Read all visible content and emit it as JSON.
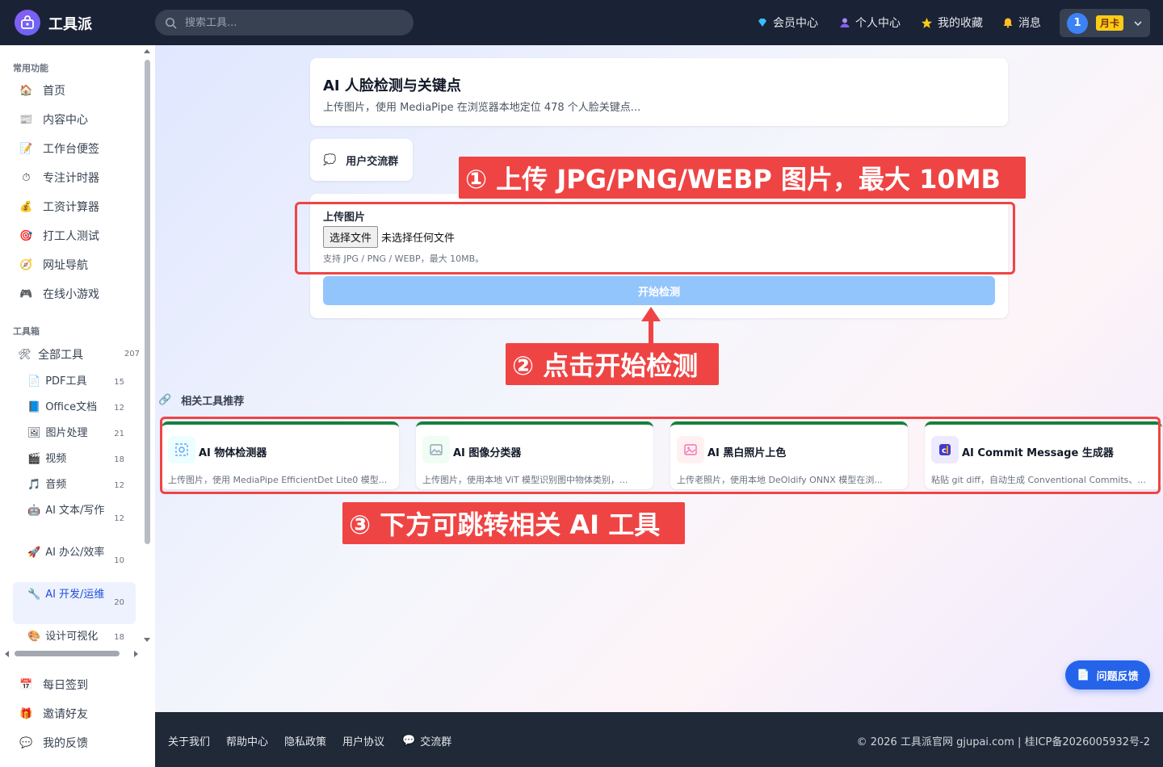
{
  "header": {
    "brand": "工具派",
    "search_placeholder": "搜索工具...",
    "nav": [
      "会员中心",
      "个人中心",
      "我的收藏",
      "消息"
    ],
    "user_number": "1",
    "plan_badge": "月卡"
  },
  "sidebar": {
    "section_common": "常用功能",
    "common_items": [
      "首页",
      "内容中心",
      "工作台便签",
      "专注计时器",
      "工资计算器",
      "打工人测试",
      "网址导航",
      "在线小游戏"
    ],
    "section_tools": "工具箱",
    "all_tools_label": "全部工具",
    "all_tools_count": "207",
    "categories": [
      {
        "label": "PDF工具",
        "count": "15"
      },
      {
        "label": "Office文档",
        "count": "12"
      },
      {
        "label": "图片处理",
        "count": "21"
      },
      {
        "label": "视频",
        "count": "18"
      },
      {
        "label": "音频",
        "count": "12"
      },
      {
        "label": "AI 文本/写作",
        "count": "12"
      },
      {
        "label": "AI 办公/效率",
        "count": "10"
      },
      {
        "label": "AI 开发/运维",
        "count": "20"
      },
      {
        "label": "设计可视化",
        "count": "18"
      }
    ],
    "bottom_items": [
      "每日签到",
      "邀请好友",
      "我的反馈"
    ]
  },
  "tool": {
    "title": "AI 人脸检测与关键点",
    "subtitle": "上传图片，使用 MediaPipe 在浏览器本地定位 478 个人脸关键点...",
    "group_label": "用户交流群",
    "upload_label": "上传图片",
    "file_button": "选择文件",
    "file_status": "未选择任何文件",
    "upload_hint": "支持 JPG / PNG / WEBP，最大 10MB。",
    "start_button": "开始检测"
  },
  "related": {
    "title": "相关工具推荐",
    "cards": [
      {
        "name": "AI 物体检测器",
        "desc": "上传图片，使用 MediaPipe EfficientDet Lite0 模型..."
      },
      {
        "name": "AI 图像分类器",
        "desc": "上传图片，使用本地 ViT 模型识别图中物体类别，..."
      },
      {
        "name": "AI 黑白照片上色",
        "desc": "上传老照片，使用本地 DeOldify ONNX 模型在浏..."
      },
      {
        "name": "AI Commit Message 生成器",
        "desc": "粘贴 git diff，自动生成 Conventional Commits、..."
      }
    ]
  },
  "annotations": {
    "step1": "① 上传 JPG/PNG/WEBP 图片，最大 10MB",
    "step2": "② 点击开始检测",
    "step3": "③ 下方可跳转相关 AI 工具"
  },
  "feedback_label": "问题反馈",
  "footer": {
    "links": [
      "关于我们",
      "帮助中心",
      "隐私政策",
      "用户协议",
      "交流群"
    ],
    "copyright": "© 2026 工具派官网 gjupai.com | 桂ICP备2026005932号-2"
  },
  "colors": {
    "accent": "#2563eb",
    "annotation": "#ef4444",
    "topbar": "#1a2236",
    "card_top": "#15803d"
  }
}
